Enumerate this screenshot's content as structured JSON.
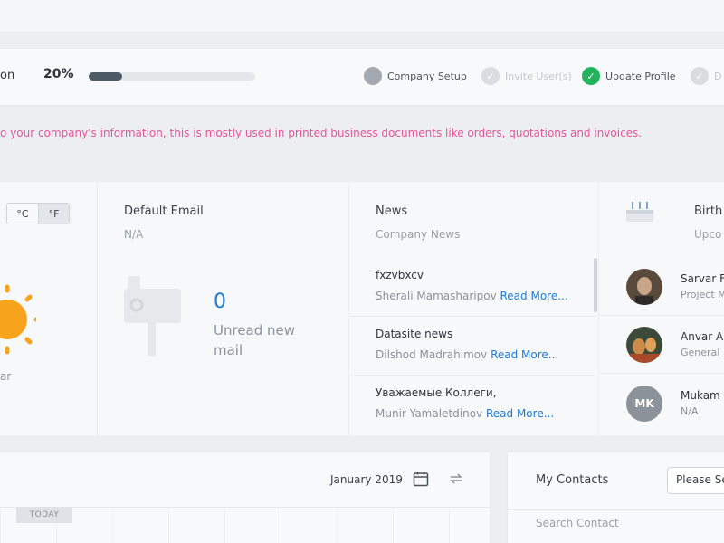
{
  "progress": {
    "label_fragment": "on",
    "percent_text": "20%",
    "fraction": 0.2,
    "steps": [
      {
        "label": "Company Setup",
        "state": "current"
      },
      {
        "label": "Invite User(s)",
        "state": "done-dim"
      },
      {
        "label": "Update Profile",
        "state": "done"
      },
      {
        "label": "D",
        "state": "done-dim"
      }
    ]
  },
  "notice": "o your company's information, this is mostly used in printed business documents like orders, quotations and invoices.",
  "weather": {
    "unit_c": "°C",
    "unit_f": "°F",
    "city_fragment": "ar"
  },
  "email": {
    "title": "Default Email",
    "address": "N/A",
    "unread_count": "0",
    "unread_label": "Unread new mail"
  },
  "news": {
    "title": "News",
    "subtitle": "Company News",
    "read_more": "Read More...",
    "items": [
      {
        "title": "fxzvbxcv",
        "author": "Sherali Mamasharipov"
      },
      {
        "title": "Datasite news",
        "author": "Dilshod Madrahimov"
      },
      {
        "title": "Уважаемые Коллеги,",
        "author": "Munir Yamaletdinov"
      }
    ]
  },
  "birthdays": {
    "title": "Birth",
    "subtitle": "Upco",
    "people": [
      {
        "name": "Sarvar F",
        "role": "Project M"
      },
      {
        "name": "Anvar A",
        "role": "General"
      },
      {
        "name": "Mukam",
        "role": "N/A",
        "initials": "MK"
      }
    ]
  },
  "calendar": {
    "month": "January 2019",
    "today": "TODAY"
  },
  "contacts": {
    "title": "My Contacts",
    "select_value": "Please Se",
    "search_placeholder": "Search Contact"
  },
  "colors": {
    "accent": "#1f7bd6",
    "success": "#22b35c",
    "notice": "#e8559a",
    "progress": "#4f5a67"
  }
}
